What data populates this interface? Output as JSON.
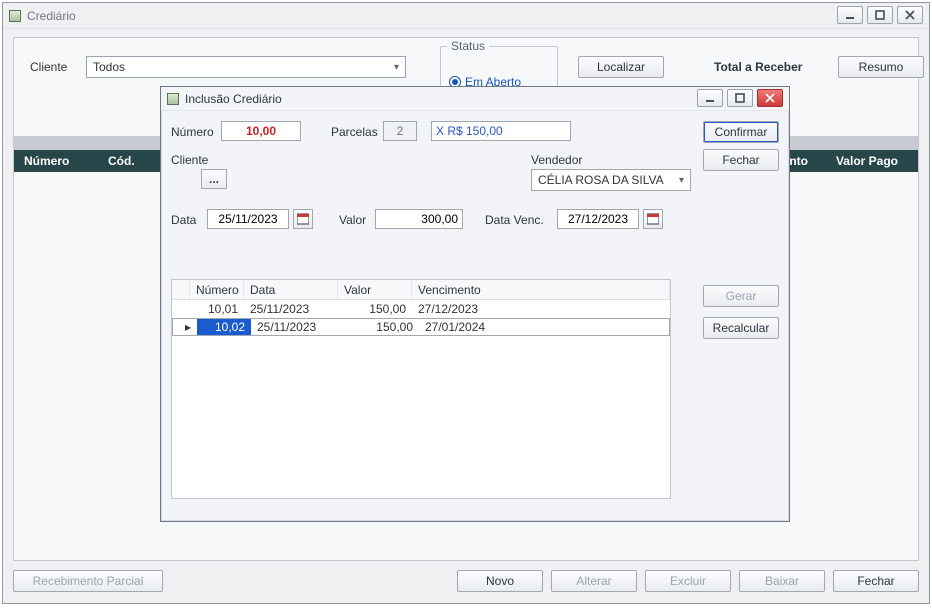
{
  "main": {
    "title": "Crediário",
    "cliente_label": "Cliente",
    "cliente_value": "Todos",
    "status_legend": "Status",
    "status_em_aberto": "Em Aberto",
    "localizar": "Localizar",
    "total_label": "Total a Receber",
    "resumo": "Resumo",
    "grid": {
      "numero": "Número",
      "cod": "Cód.",
      "conto": "conto",
      "valor_pago": "Valor Pago"
    },
    "bottom": {
      "recebimento": "Recebimento Parcial",
      "novo": "Novo",
      "alterar": "Alterar",
      "excluir": "Excluir",
      "baixar": "Baixar",
      "fechar": "Fechar"
    }
  },
  "dialog": {
    "title": "Inclusão Crediário",
    "numero_label": "Número",
    "numero_value": "10,00",
    "parcelas_label": "Parcelas",
    "parcelas_value": "2",
    "x_parcela": "X R$ 150,00",
    "cliente_label": "Cliente",
    "cliente_btn": "...",
    "vendedor_label": "Vendedor",
    "vendedor_value": "CÉLIA ROSA DA SILVA",
    "confirmar": "Confirmar",
    "fechar": "Fechar",
    "data_label": "Data",
    "data_value": "25/11/2023",
    "valor_label": "Valor",
    "valor_value": "300,00",
    "datavenc_label": "Data Venc.",
    "datavenc_value": "27/12/2023",
    "grid_headers": {
      "numero": "Número",
      "data": "Data",
      "valor": "Valor",
      "venc": "Vencimento"
    },
    "rows": [
      {
        "numero": "10,01",
        "data": "25/11/2023",
        "valor": "150,00",
        "venc": "27/12/2023",
        "selected": false,
        "marker": " "
      },
      {
        "numero": "10,02",
        "data": "25/11/2023",
        "valor": "150,00",
        "venc": "27/01/2024",
        "selected": true,
        "marker": "▸"
      }
    ],
    "gerar": "Gerar",
    "recalcular": "Recalcular"
  }
}
